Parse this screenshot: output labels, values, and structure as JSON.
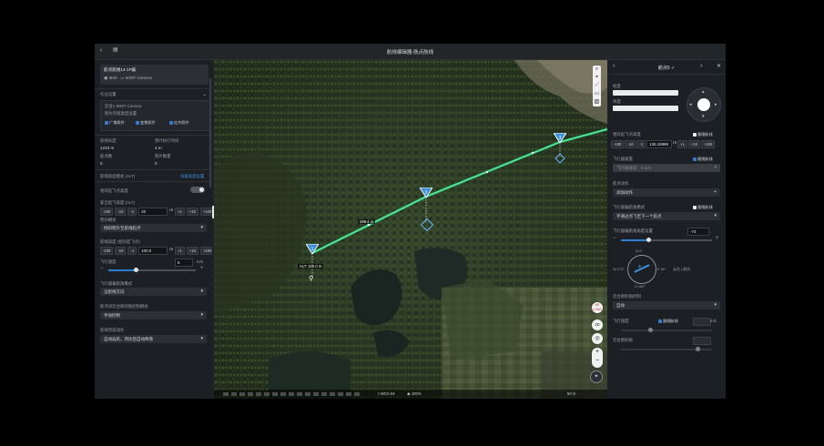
{
  "window": {
    "title": "航线编辑器-航点航线"
  },
  "left": {
    "route_name": "航点航线14-1F编",
    "drone": "M30",
    "camera": "M30T Camera",
    "section_title": "作业设置",
    "payload_label": "云台1 M30T Camera",
    "payload_sub": "照片存储类型设置",
    "photo_options": [
      "广角照片",
      "变焦照片",
      "红外照片"
    ],
    "stats": [
      {
        "label": "航线长度",
        "value": "1223 m"
      },
      {
        "label": "预计执行时间",
        "value": "4 m"
      },
      {
        "label": "航点数",
        "value": "5"
      },
      {
        "label": "照片数量",
        "value": "0"
      }
    ],
    "alt_mode_label": "航线高度模式 (ALT)",
    "alt_mode_link": "海拔高度设置",
    "follow_terrain_label": "相对起飞点高度",
    "safe_alt_label": "安全起飞高度 (ALT)",
    "safe_alt_buttons": [
      "-100",
      "-10",
      "-1",
      "+1",
      "+10",
      "+100"
    ],
    "safe_alt_value": "20",
    "safe_alt_unit": "m",
    "climb_mode_label": "爬升模式",
    "climb_mode_value": "倾斜爬升至航线起点",
    "route_alt_label": "航线高度 (相对起飞点)",
    "route_alt_buttons": [
      "-100",
      "-10",
      "-1",
      "+1",
      "+10",
      "+100"
    ],
    "route_alt_value": "100.0",
    "route_alt_unit": "m",
    "speed_label": "飞行速度",
    "speed_value": "5",
    "speed_unit": "m/s",
    "speed_fraction": 0.32,
    "heading_label": "飞行器偏航角模式",
    "heading_value": "沿航线方向",
    "turn_label": "航点间云台俯仰角控制模式",
    "turn_value": "手动控制",
    "finish_label": "航线完成动作",
    "finish_value": "自动返航，到达后自动降落"
  },
  "map": {
    "distance_label": "289.4 m",
    "alt_label": "ALT: 100.0 m",
    "waypoint_labels": [
      "1",
      "2",
      "3"
    ],
    "compass_badge": "NE LOAD",
    "view_2d": "2D",
    "scale": "50 m",
    "coords": "WGS 84",
    "zoom": "100%",
    "zoom_in": "+",
    "zoom_out": "−"
  },
  "right": {
    "title": "航点5 ✓",
    "lng_label": "经度",
    "lat_label": "纬度",
    "alt_label": "相对起飞点高度",
    "alt_link": "跟随航线",
    "alt_buttons": [
      "-100",
      "-10",
      "-1",
      "+1",
      "+10",
      "+100"
    ],
    "alt_value": "136.19999",
    "alt_unit": "m",
    "speed_type_label": "飞行器速度",
    "speed_type_link": "跟随航线",
    "speed_select": "飞行器速度：5 m/s",
    "action_label": "航点动作",
    "action_value": "添加动作",
    "turn_label": "飞行器偏航角模式",
    "turn_link": "跟随航线",
    "turn_value": "平滑过点飞至下一个航点",
    "yaw_label": "飞行器偏航角角度设置",
    "yaw_value": "-74",
    "yaw_fraction": 0.3,
    "compass_n": "N 0°",
    "compass_s": "S 180°",
    "compass_w": "W 270°",
    "compass_e": "E 90°",
    "compass_legend": "云台 | 航向",
    "gimbal_label": "云台俯仰角控制",
    "gimbal_value": "自动",
    "speed2_label": "飞行速度",
    "speed2_link": "跟随航线",
    "speed2_unit": "m/s",
    "pitch_label": "云台俯仰角"
  }
}
